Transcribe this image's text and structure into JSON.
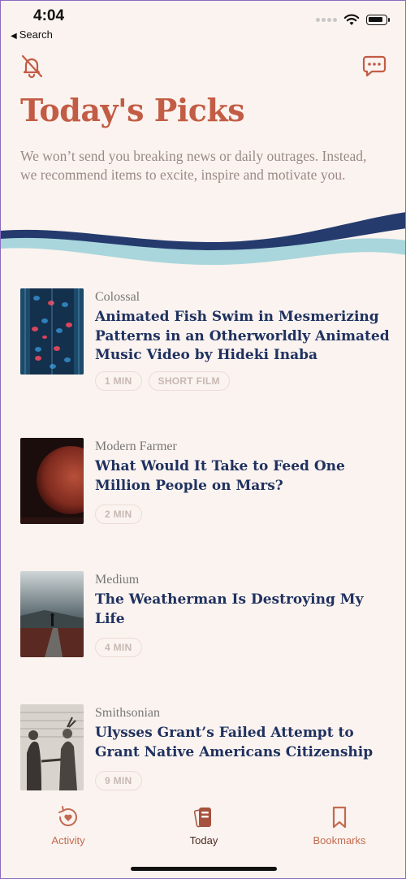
{
  "status_bar": {
    "time": "4:04",
    "back_label": "Search"
  },
  "header": {
    "title": "Today's Picks",
    "subtitle": "We won’t send you breaking news or daily outrages. Instead, we recommend items to excite, inspire and motivate you.",
    "left_icon": "notifications-off-icon",
    "right_icon": "chat-icon"
  },
  "articles": [
    {
      "source": "Colossal",
      "title": "Animated Fish Swim in Mesmerizing Patterns in an Otherworldly Animated Music Video by Hideki Inaba",
      "tags": [
        "1 MIN",
        "SHORT FILM"
      ]
    },
    {
      "source": "Modern Farmer",
      "title": "What Would It Take to Feed One Million People on Mars?",
      "tags": [
        "2 MIN"
      ]
    },
    {
      "source": "Medium",
      "title": "The Weatherman Is Destroying My Life",
      "tags": [
        "4 MIN"
      ]
    },
    {
      "source": "Smithsonian",
      "title": "Ulysses Grant’s Failed Attempt to Grant Native Americans Citizenship",
      "tags": [
        "9 MIN"
      ]
    }
  ],
  "tabs": [
    {
      "label": "Activity",
      "icon": "activity-heart-icon"
    },
    {
      "label": "Today",
      "icon": "today-card-icon",
      "active": true
    },
    {
      "label": "Bookmarks",
      "icon": "bookmark-icon"
    }
  ],
  "colors": {
    "accent": "#c25c45",
    "headline": "#1f3160",
    "background": "#fbf3ef",
    "wave_dark": "#253b6e",
    "wave_light": "#a9d6dc"
  }
}
